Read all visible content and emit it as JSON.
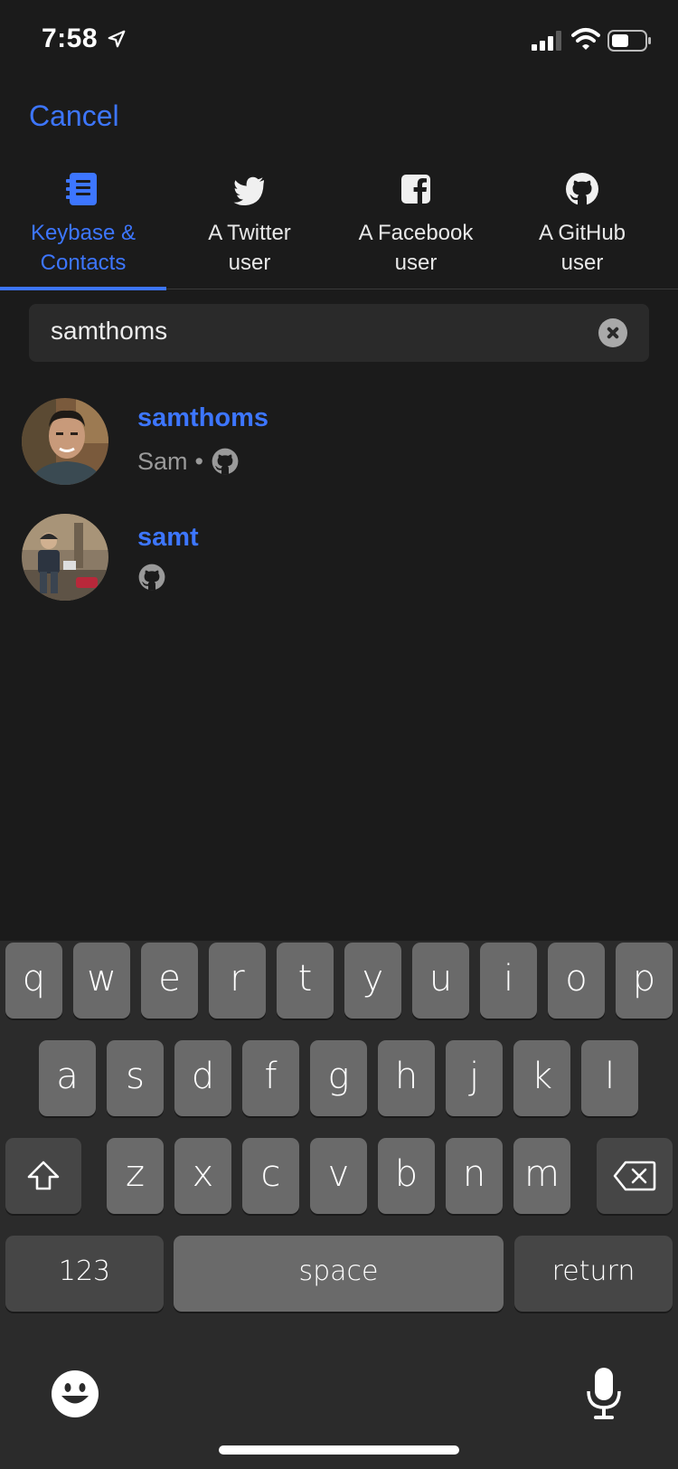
{
  "status": {
    "time": "7:58"
  },
  "header": {
    "cancel_label": "Cancel"
  },
  "tabs": [
    {
      "label": "Keybase &\nContacts",
      "icon": "address-book-icon",
      "active": true
    },
    {
      "label": "A Twitter\nuser",
      "icon": "twitter-icon",
      "active": false
    },
    {
      "label": "A Facebook\nuser",
      "icon": "facebook-icon",
      "active": false
    },
    {
      "label": "A GitHub\nuser",
      "icon": "github-icon",
      "active": false
    }
  ],
  "search": {
    "value": "samthoms"
  },
  "results": [
    {
      "username": "samthoms",
      "full_name": "Sam",
      "separator": "•",
      "service_icon": "github-icon"
    },
    {
      "username": "samt",
      "full_name": "",
      "service_icon": "github-icon"
    }
  ],
  "keyboard": {
    "row1": [
      "q",
      "w",
      "e",
      "r",
      "t",
      "y",
      "u",
      "i",
      "o",
      "p"
    ],
    "row2": [
      "a",
      "s",
      "d",
      "f",
      "g",
      "h",
      "j",
      "k",
      "l"
    ],
    "row3": [
      "z",
      "x",
      "c",
      "v",
      "b",
      "n",
      "m"
    ],
    "numbers_label": "123",
    "space_label": "space",
    "return_label": "return"
  },
  "colors": {
    "accent": "#3d76ff",
    "background": "#1b1b1b",
    "key": "#6a6a6a",
    "key_dark": "#464646"
  }
}
